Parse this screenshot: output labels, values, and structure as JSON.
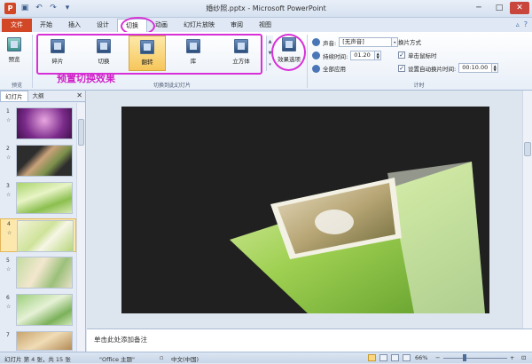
{
  "window": {
    "title": "婚纱照.pptx  -  Microsoft PowerPoint",
    "app_icon": "P",
    "qat_icons": [
      "save-icon",
      "undo-icon",
      "redo-icon",
      "customize-icon"
    ],
    "controls": [
      "minimize-icon",
      "maximize-icon",
      "close-icon"
    ],
    "controls_glyphs": [
      "─",
      "□",
      "✕"
    ]
  },
  "ribbon_tabs": [
    "文件",
    "开始",
    "插入",
    "设计",
    "切换",
    "动画",
    "幻灯片放映",
    "审阅",
    "视图"
  ],
  "active_tab": "切换",
  "tabbar_right_glyphs": [
    "▵",
    "?"
  ],
  "ribbon": {
    "preview": {
      "label": "预览",
      "group": "预览"
    },
    "transitions": [
      {
        "label": "碎片",
        "selected": false
      },
      {
        "label": "切换",
        "selected": false
      },
      {
        "label": "翻转",
        "selected": true
      },
      {
        "label": "库",
        "selected": false
      },
      {
        "label": "立方体",
        "selected": false
      }
    ],
    "transitions_group": "切换到此幻灯片",
    "effect_options_label": "效果选项",
    "annotation": "预置切换效果",
    "timing": {
      "sound_label": "声音:",
      "sound_value": "[无声音]",
      "duration_label": "持续时间:",
      "duration_value": "01.20",
      "apply_all_label": "全部应用",
      "advance_label": "换片方式",
      "on_click_label": "单击鼠标时",
      "on_click_checked": true,
      "after_label": "设置自动换片时间:",
      "after_checked": true,
      "after_value": "00:10.00",
      "group": "计时"
    }
  },
  "sidebar": {
    "tabs": [
      "幻灯片",
      "大纲"
    ],
    "close_glyph": "✕",
    "slides": [
      {
        "number": "1",
        "current": false
      },
      {
        "number": "2",
        "current": false
      },
      {
        "number": "3",
        "current": false
      },
      {
        "number": "4",
        "current": true
      },
      {
        "number": "5",
        "current": false
      },
      {
        "number": "6",
        "current": false
      },
      {
        "number": "7",
        "current": false
      }
    ],
    "star_glyph": "☆"
  },
  "notes_placeholder": "单击此处添加备注",
  "status": {
    "slide_info": "幻灯片 第 4 张，共 15 张",
    "theme": "\"Office 主题\"",
    "language": "中文(中国)",
    "zoom": "66%",
    "zoom_minus": "−",
    "zoom_plus": "+"
  },
  "colors": {
    "file_tab": "#d24726",
    "annotation": "#d020c8",
    "selected_transition": "#f6c65b"
  }
}
